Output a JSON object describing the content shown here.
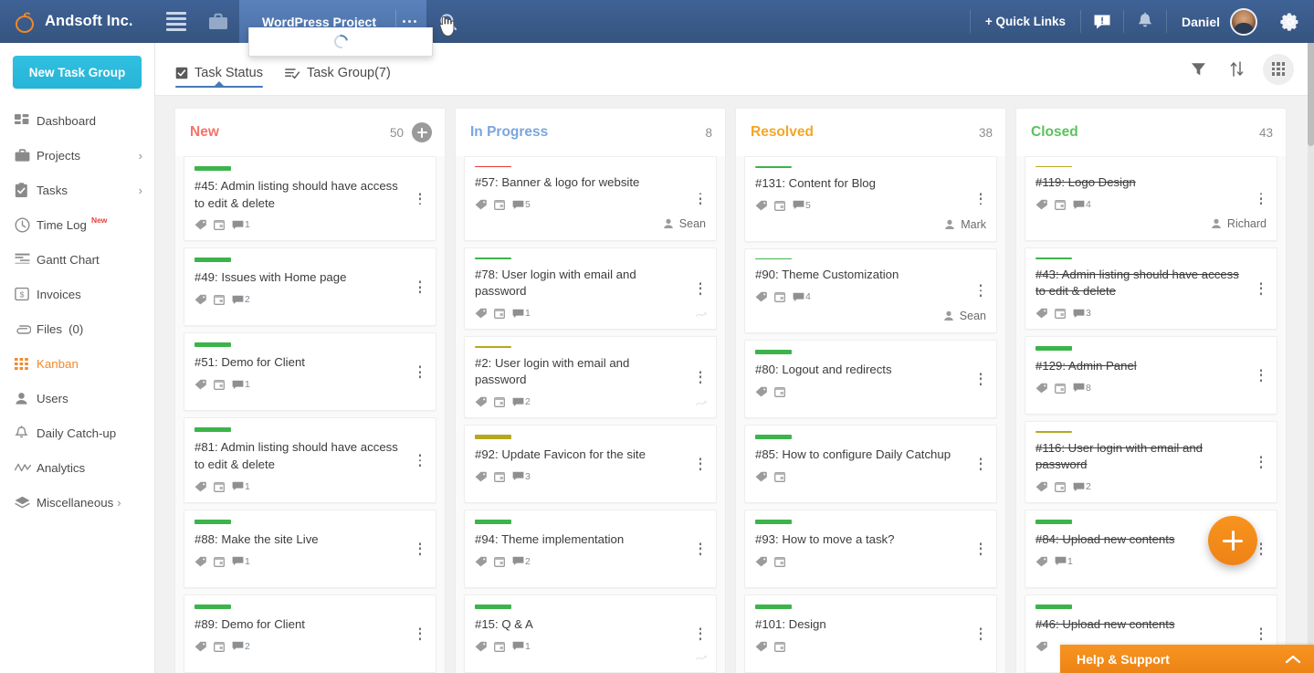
{
  "topbar": {
    "brand": "Andsoft Inc.",
    "brand_logo_icon": "pumpkin-logo-icon",
    "menu_icon": "hamburger-menu-icon",
    "briefcase_icon": "briefcase-icon",
    "project_name": "WordPress Project",
    "project_more_icon": "ellipsis-icon",
    "search_icon": "search-icon",
    "quick_links": "+ Quick Links",
    "announcement_icon": "announcement-icon",
    "notification_icon": "bell-icon",
    "user_name": "Daniel",
    "avatar_icon": "user-avatar",
    "settings_icon": "gear-icon",
    "dropdown_state": "loading"
  },
  "sidebar": {
    "new_task_group_label": "New Task Group",
    "items": [
      {
        "label": "Dashboard",
        "icon": "dashboard-grid-icon",
        "chevron": "",
        "active": false
      },
      {
        "label": "Projects",
        "icon": "briefcase-icon",
        "chevron": "›",
        "active": false
      },
      {
        "label": "Tasks",
        "icon": "clipboard-check-icon",
        "chevron": "›",
        "active": false
      },
      {
        "label": "Time Log",
        "icon": "clock-icon",
        "chevron": "",
        "active": false,
        "badge": "New"
      },
      {
        "label": "Gantt Chart",
        "icon": "gantt-chart-icon",
        "chevron": "",
        "active": false
      },
      {
        "label": "Invoices",
        "icon": "dollar-box-icon",
        "chevron": "",
        "active": false
      },
      {
        "label": "Files",
        "icon": "paperclip-icon",
        "chevron": "",
        "active": false,
        "count": "(0)"
      },
      {
        "label": "Kanban",
        "icon": "kanban-grid-icon",
        "chevron": "",
        "active": true
      },
      {
        "label": "Users",
        "icon": "user-icon",
        "chevron": "",
        "active": false
      },
      {
        "label": "Daily Catch-up",
        "icon": "bell-icon",
        "chevron": "",
        "active": false
      },
      {
        "label": "Analytics",
        "icon": "line-chart-icon",
        "chevron": "",
        "active": false
      },
      {
        "label": "Miscellaneous",
        "icon": "layers-icon",
        "chevron": "›",
        "active": false
      }
    ]
  },
  "tabs": [
    {
      "label": "Task Status",
      "icon": "checkbox-icon",
      "active": true
    },
    {
      "label": "Task Group(7)",
      "icon": "list-check-icon",
      "active": false
    }
  ],
  "toolbar": {
    "filter_icon": "filter-funnel-icon",
    "sort_icon": "sort-arrows-icon",
    "grid_view_icon": "grid-view-icon"
  },
  "colors": {
    "new": "#f4736a",
    "in_progress": "#7aa6dd",
    "resolved": "#f5a623",
    "closed": "#5cc25c",
    "priority_high": "#e23c33",
    "priority_medium": "#b5a81d",
    "priority_low": "#3cb44b",
    "accent_orange": "#f7941e",
    "accent_cyan": "#2bbcd8",
    "header_blue": "#3f6296"
  },
  "fab": {
    "icon": "plus-icon"
  },
  "help": {
    "label": "Help & Support",
    "icon": "chevron-up-icon"
  },
  "board": {
    "columns": [
      {
        "title": "New",
        "count": "50",
        "color": "#f4736a",
        "has_add": true,
        "cards": [
          {
            "title": "#45: Admin listing should have access to edit & delete",
            "priority": "#3cb44b",
            "comments": "1",
            "has_tag": true,
            "has_calendar": true,
            "assignee": "",
            "closed": false
          },
          {
            "title": "#49: Issues with Home page",
            "priority": "#3cb44b",
            "comments": "2",
            "has_tag": true,
            "has_calendar": true,
            "assignee": "",
            "closed": false
          },
          {
            "title": "#51: Demo for Client",
            "priority": "#3cb44b",
            "comments": "1",
            "has_tag": true,
            "has_calendar": true,
            "assignee": "",
            "closed": false
          },
          {
            "title": "#81: Admin listing should have access to edit & delete",
            "priority": "#3cb44b",
            "comments": "1",
            "has_tag": true,
            "has_calendar": true,
            "assignee": "",
            "closed": false
          },
          {
            "title": "#88: Make the site Live",
            "priority": "#3cb44b",
            "comments": "1",
            "has_tag": true,
            "has_calendar": true,
            "assignee": "",
            "closed": false
          },
          {
            "title": "#89: Demo for Client",
            "priority": "#3cb44b",
            "comments": "2",
            "has_tag": true,
            "has_calendar": true,
            "assignee": "",
            "closed": false
          }
        ]
      },
      {
        "title": "In Progress",
        "count": "8",
        "color": "#7aa6dd",
        "has_add": false,
        "cards": [
          {
            "title": "#57: Banner & logo for website",
            "priority": "#e23c33",
            "comments": "5",
            "has_tag": true,
            "has_calendar": true,
            "assignee": "Sean",
            "closed": false
          },
          {
            "title": "#78: User login with email and password",
            "priority": "#3cb44b",
            "comments": "1",
            "has_tag": true,
            "has_calendar": true,
            "assignee": "",
            "closed": false,
            "drag": true
          },
          {
            "title": "#2: User login with email and password",
            "priority": "#b5a81d",
            "comments": "2",
            "has_tag": true,
            "has_calendar": true,
            "assignee": "",
            "closed": false,
            "drag": true
          },
          {
            "title": "#92: Update Favicon for the site",
            "priority": "#b5a81d",
            "comments": "3",
            "has_tag": true,
            "has_calendar": true,
            "assignee": "",
            "closed": false
          },
          {
            "title": "#94: Theme implementation",
            "priority": "#3cb44b",
            "comments": "2",
            "has_tag": true,
            "has_calendar": true,
            "assignee": "",
            "closed": false
          },
          {
            "title": "#15: Q & A",
            "priority": "#3cb44b",
            "comments": "1",
            "has_tag": true,
            "has_calendar": true,
            "assignee": "",
            "closed": false,
            "drag": true
          }
        ]
      },
      {
        "title": "Resolved",
        "count": "38",
        "color": "#f5a623",
        "has_add": false,
        "cards": [
          {
            "title": "#131: Content for Blog",
            "priority": "#3cb44b",
            "comments": "5",
            "has_tag": true,
            "has_calendar": true,
            "assignee": "Mark",
            "closed": false
          },
          {
            "title": "#90: Theme Customization",
            "priority": "#3cb44b",
            "comments": "4",
            "has_tag": true,
            "has_calendar": true,
            "assignee": "Sean",
            "closed": false
          },
          {
            "title": "#80: Logout and redirects",
            "priority": "#3cb44b",
            "comments": "",
            "has_tag": true,
            "has_calendar": true,
            "assignee": "",
            "closed": false
          },
          {
            "title": "#85: How to configure Daily Catchup",
            "priority": "#3cb44b",
            "comments": "",
            "has_tag": true,
            "has_calendar": true,
            "assignee": "",
            "closed": false
          },
          {
            "title": "#93: How to move a task?",
            "priority": "#3cb44b",
            "comments": "",
            "has_tag": true,
            "has_calendar": true,
            "assignee": "",
            "closed": false
          },
          {
            "title": "#101: Design",
            "priority": "#3cb44b",
            "comments": "",
            "has_tag": true,
            "has_calendar": true,
            "assignee": "",
            "closed": false
          }
        ]
      },
      {
        "title": "Closed",
        "count": "43",
        "color": "#5cc25c",
        "has_add": false,
        "cards": [
          {
            "title": "#119: Logo Design",
            "priority": "#b5a81d",
            "comments": "4",
            "has_tag": true,
            "has_calendar": true,
            "assignee": "Richard",
            "closed": true
          },
          {
            "title": "#43: Admin listing should have access to edit & delete",
            "priority": "#3cb44b",
            "comments": "3",
            "has_tag": true,
            "has_calendar": true,
            "assignee": "",
            "closed": true
          },
          {
            "title": "#129: Admin Panel",
            "priority": "#3cb44b",
            "comments": "8",
            "has_tag": true,
            "has_calendar": true,
            "assignee": "",
            "closed": true
          },
          {
            "title": "#116: User login with email and password",
            "priority": "#b5a81d",
            "comments": "2",
            "has_tag": true,
            "has_calendar": true,
            "assignee": "",
            "closed": true
          },
          {
            "title": "#84: Upload new contents",
            "priority": "#3cb44b",
            "comments": "1",
            "has_tag": true,
            "has_calendar": false,
            "assignee": "",
            "closed": true
          },
          {
            "title": "#46: Upload new contents",
            "priority": "#3cb44b",
            "comments": "",
            "has_tag": true,
            "has_calendar": false,
            "assignee": "",
            "closed": true
          }
        ]
      }
    ]
  }
}
